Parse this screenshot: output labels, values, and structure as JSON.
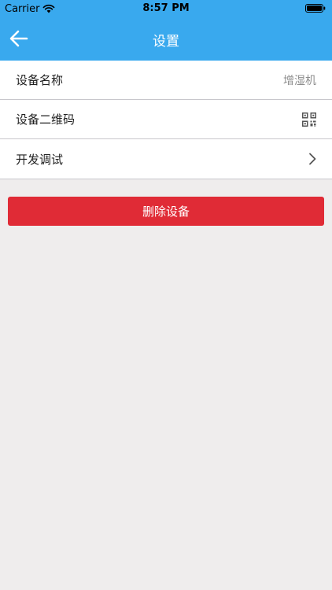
{
  "status_bar": {
    "carrier": "Carrier",
    "time": "8:57 PM",
    "wifi_icon": "wifi-icon",
    "battery_icon": "battery-icon"
  },
  "nav": {
    "title": "设置",
    "back_icon": "arrow-left-icon",
    "background_color": "#39a9ee"
  },
  "settings": {
    "items": [
      {
        "label": "设备名称",
        "value": "增湿机"
      },
      {
        "label": "设备二维码",
        "icon": "qr-code-icon"
      },
      {
        "label": "开发调试",
        "icon": "chevron-right-icon"
      }
    ]
  },
  "actions": {
    "delete_label": "删除设备",
    "delete_color": "#e02b36"
  }
}
